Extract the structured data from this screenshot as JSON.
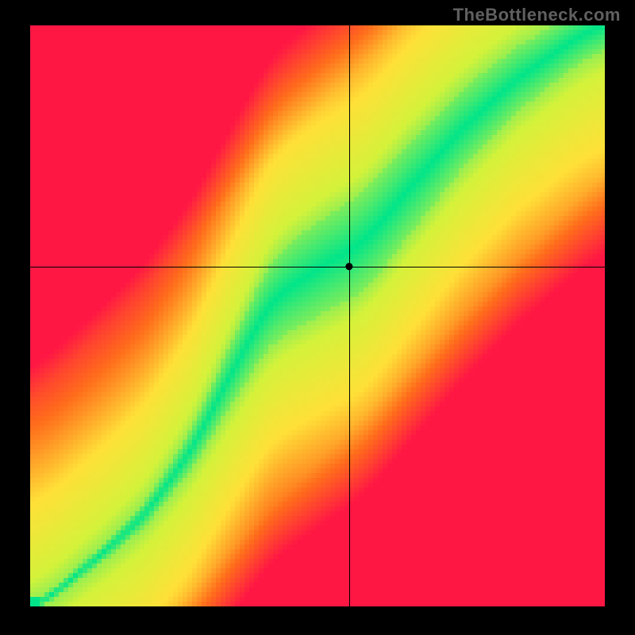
{
  "watermark": "TheBottleneck.com",
  "chart_data": {
    "type": "heatmap",
    "title": "",
    "xlabel": "",
    "ylabel": "",
    "xlim": [
      0,
      1
    ],
    "ylim": [
      0,
      1
    ],
    "crosshair": {
      "x": 0.555,
      "y": 0.585
    },
    "ridge": {
      "description": "Green optimal band curving from bottom-left corner, through center, toward upper-right; slightly S-shaped with a bulge around y=0.55",
      "points_xy": [
        [
          0.0,
          0.0
        ],
        [
          0.1,
          0.07
        ],
        [
          0.2,
          0.16
        ],
        [
          0.28,
          0.27
        ],
        [
          0.35,
          0.4
        ],
        [
          0.42,
          0.52
        ],
        [
          0.5,
          0.58
        ],
        [
          0.58,
          0.63
        ],
        [
          0.66,
          0.72
        ],
        [
          0.75,
          0.82
        ],
        [
          0.85,
          0.91
        ],
        [
          1.0,
          1.0
        ]
      ],
      "band_halfwidth_min": 0.008,
      "band_halfwidth_max": 0.085
    },
    "colorscale": {
      "0.00": "#ff1744",
      "0.25": "#ff6d1b",
      "0.50": "#ffe038",
      "0.75": "#d4f23a",
      "1.00": "#00e58a"
    },
    "grid": false,
    "pixelated": true
  }
}
